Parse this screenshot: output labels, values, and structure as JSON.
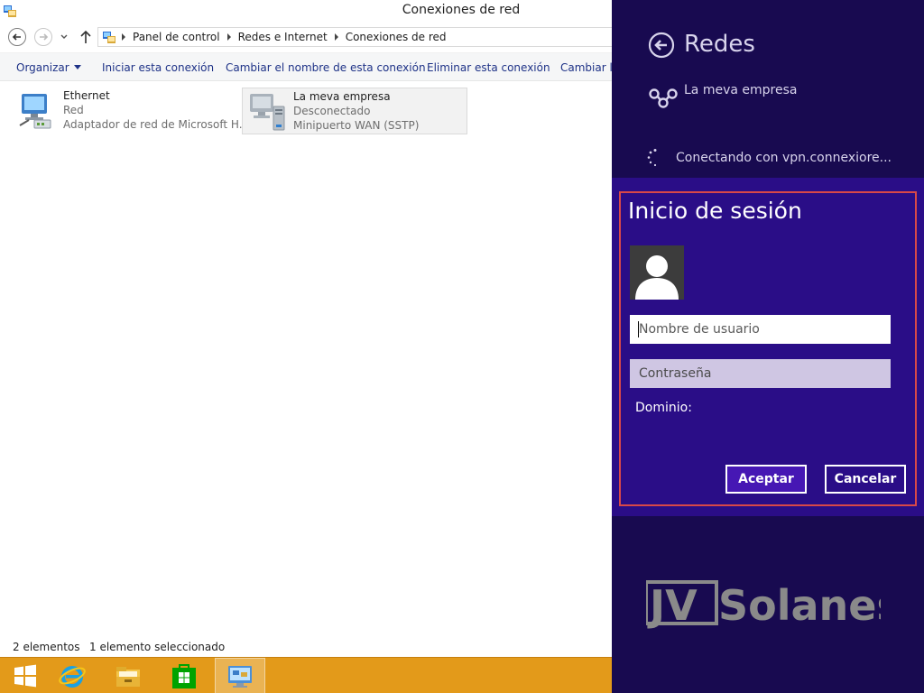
{
  "explorer": {
    "title": "Conexiones de red",
    "breadcrumb": [
      "Panel de control",
      "Redes e Internet",
      "Conexiones de red"
    ],
    "toolbar": {
      "organize": "Organizar",
      "start": "Iniciar esta conexión",
      "rename": "Cambiar el nombre de esta conexión",
      "delete": "Eliminar esta conexión",
      "change": "Cambiar la"
    },
    "connections": [
      {
        "name": "Ethernet",
        "status": "Red",
        "device": "Adaptador de red de Microsoft H..."
      },
      {
        "name": "La meva empresa",
        "status": "Desconectado",
        "device": "Minipuerto WAN (SSTP)"
      }
    ],
    "status": {
      "count": "2 elementos",
      "selected": "1 elemento seleccionado"
    }
  },
  "taskbar": {
    "items": [
      "start-icon",
      "internet-explorer-icon",
      "file-explorer-icon",
      "store-icon",
      "network-connections-icon"
    ]
  },
  "charm": {
    "title": "Redes",
    "vpn_name": "La meva empresa",
    "connecting_text": "Conectando con vpn.connexiore...",
    "login": {
      "title": "Inicio de sesión",
      "username_placeholder": "Nombre de usuario",
      "password_placeholder": "Contraseña",
      "domain_label": "Dominio:",
      "accept_label": "Aceptar",
      "cancel_label": "Cancelar"
    },
    "watermark": "JVSolanes"
  },
  "colors": {
    "charm_bg": "#180a50",
    "login_bg": "#2a0d87",
    "highlight_outline": "#d94848",
    "accept_bg": "#4617b4",
    "taskbar": "#e39a1a",
    "toolbar_text": "#1e3287"
  }
}
